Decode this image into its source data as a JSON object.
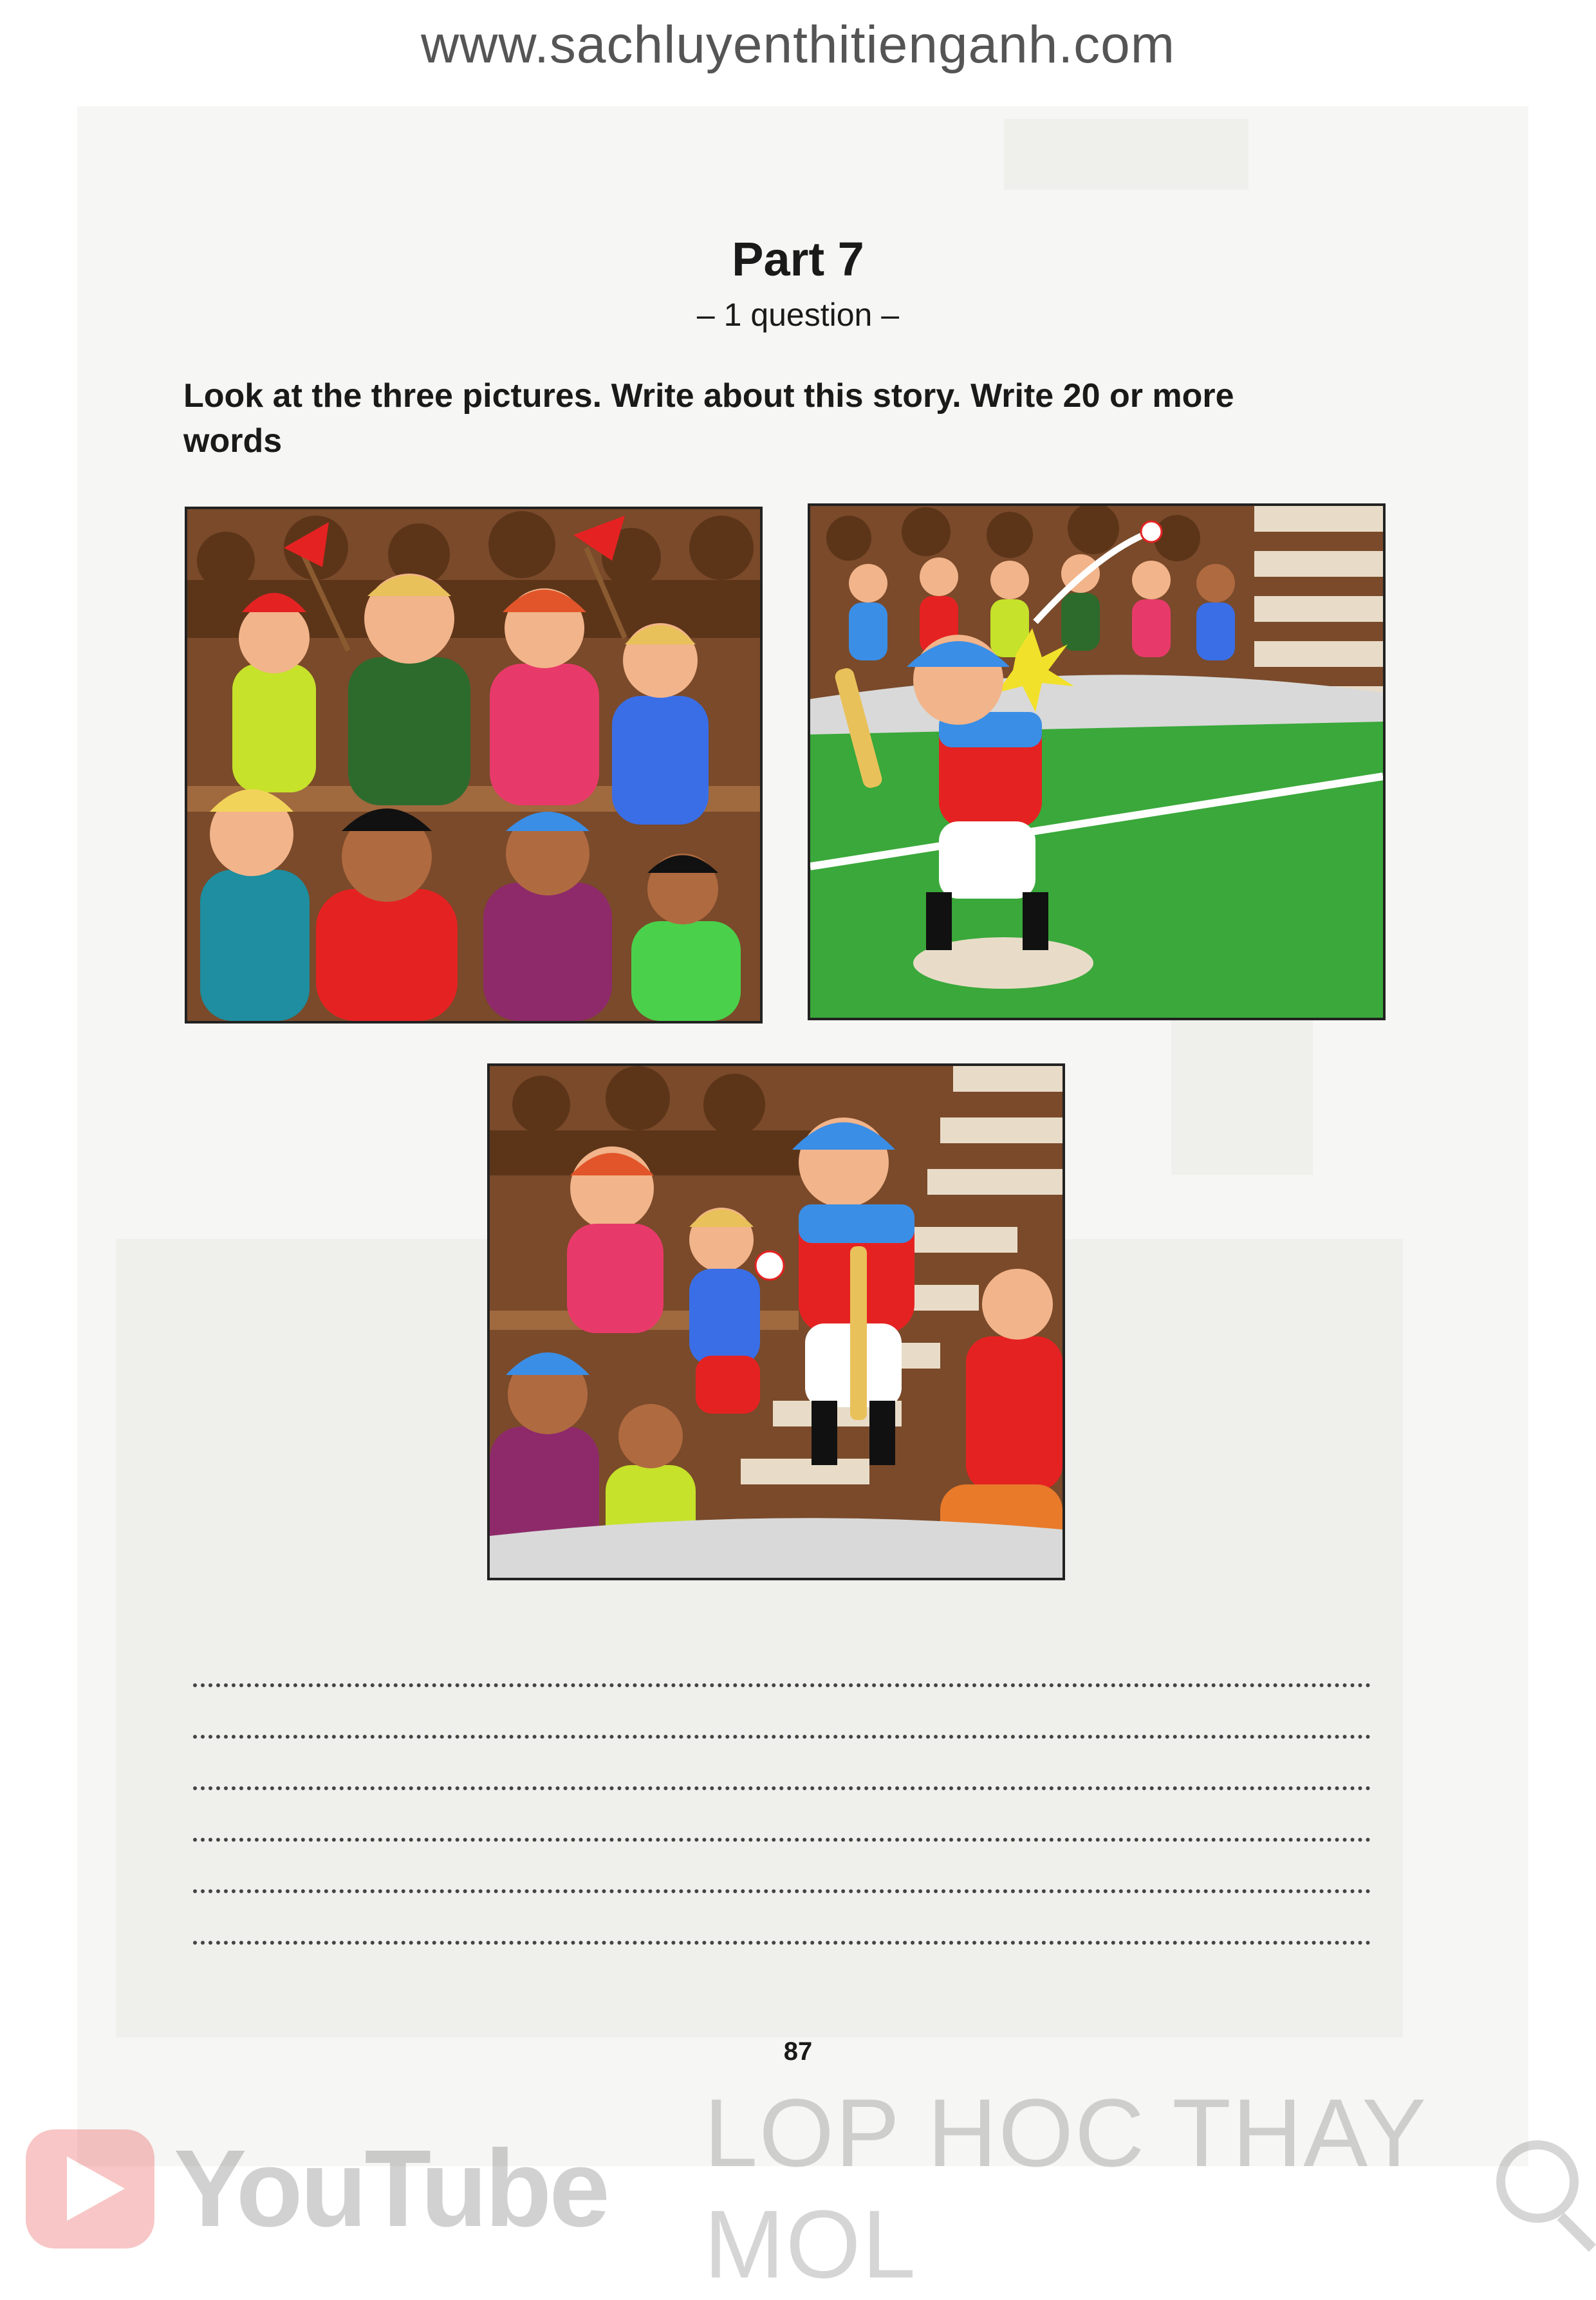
{
  "site": {
    "url": "www.sachluyenthitienganh.com"
  },
  "part": {
    "title": "Part 7",
    "subtitle": "– 1 question –",
    "instruction": "Look at the three pictures. Write about this story. Write 20 or more words"
  },
  "pictures": [
    {
      "icon": "cheering-crowd-illustration"
    },
    {
      "icon": "batter-hitting-ball-illustration"
    },
    {
      "icon": "batter-giving-ball-to-boy-illustration"
    }
  ],
  "answer_lines": 6,
  "page_number": "87",
  "watermark": {
    "brand": "YouTube",
    "channel": "LOP HOC THAY MOL"
  },
  "colors": {
    "stand_brown": "#7a4a2a",
    "field_green": "#3aa83a",
    "jersey_red": "#e52222",
    "cap_blue": "#3a8ee6"
  }
}
